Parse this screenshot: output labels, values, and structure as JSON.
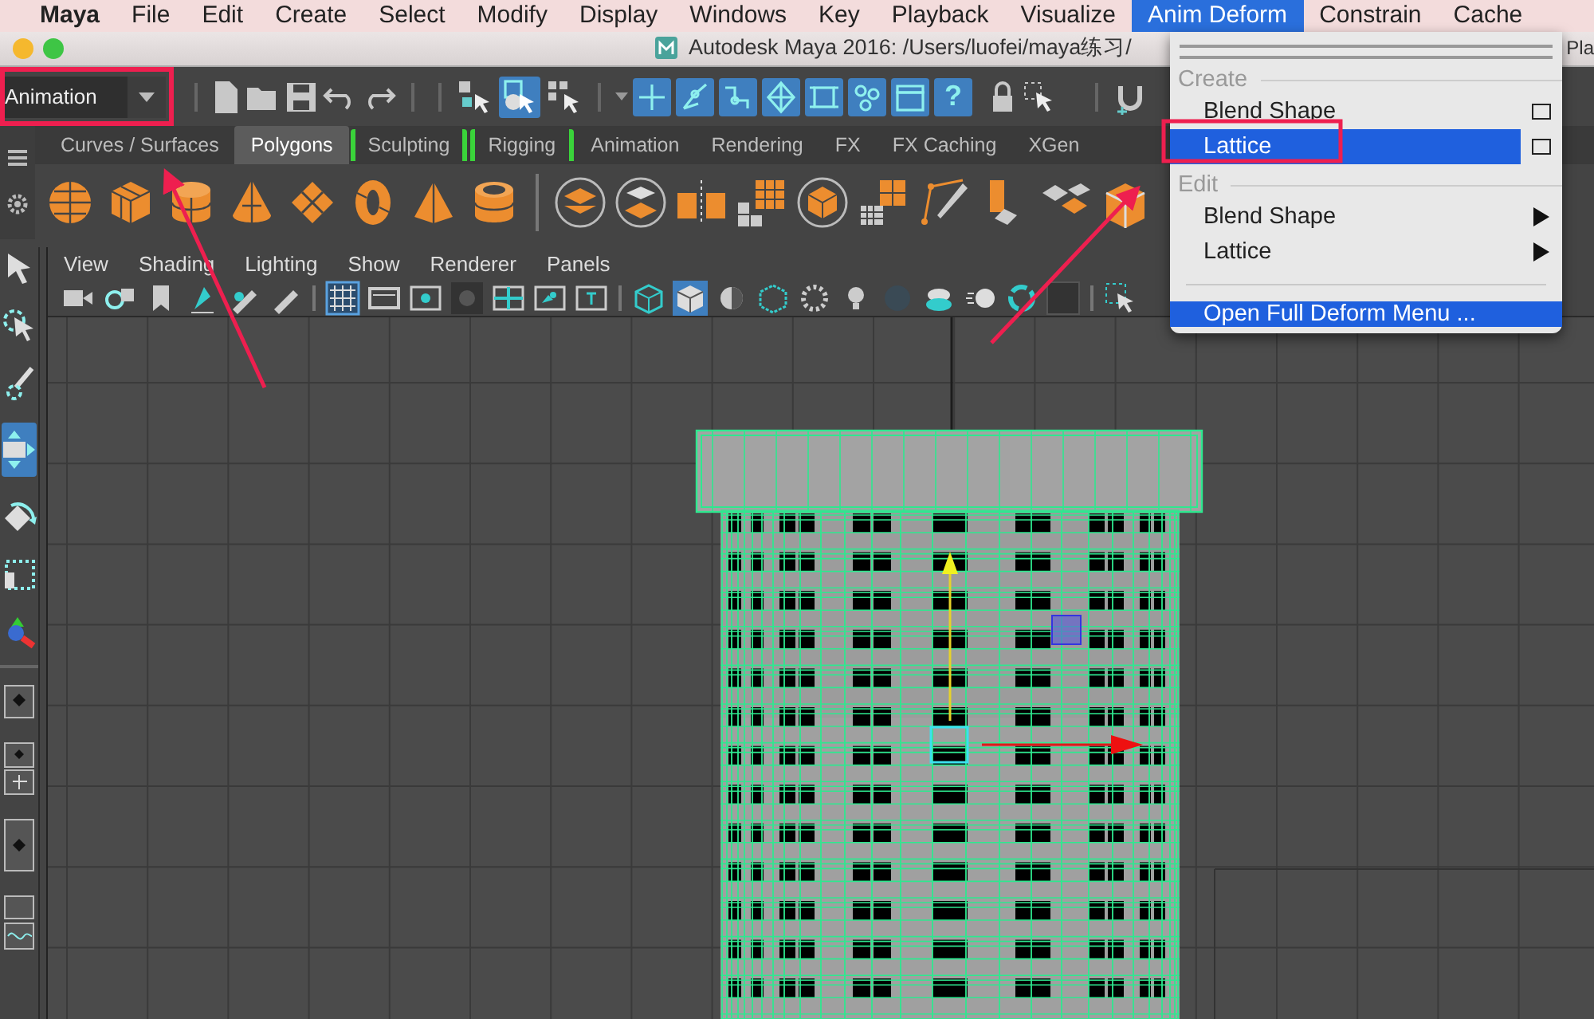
{
  "menu_bar": {
    "items": [
      {
        "label": "Maya",
        "kind": "app",
        "selected": false
      },
      {
        "label": "File",
        "kind": "menu",
        "selected": false
      },
      {
        "label": "Edit",
        "kind": "menu",
        "selected": false
      },
      {
        "label": "Create",
        "kind": "menu",
        "selected": false
      },
      {
        "label": "Select",
        "kind": "menu",
        "selected": false
      },
      {
        "label": "Modify",
        "kind": "menu",
        "selected": false
      },
      {
        "label": "Display",
        "kind": "menu",
        "selected": false
      },
      {
        "label": "Windows",
        "kind": "menu",
        "selected": false
      },
      {
        "label": "Key",
        "kind": "menu",
        "selected": false
      },
      {
        "label": "Playback",
        "kind": "menu",
        "selected": false
      },
      {
        "label": "Visualize",
        "kind": "menu",
        "selected": false
      },
      {
        "label": "Anim Deform",
        "kind": "menu",
        "selected": true
      },
      {
        "label": "Constrain",
        "kind": "menu",
        "selected": false
      },
      {
        "label": "Cache",
        "kind": "menu",
        "selected": false
      }
    ]
  },
  "window": {
    "title": "Autodesk Maya 2016: /Users/luofei/maya练习/",
    "title_tail": "Pla"
  },
  "menu_set": {
    "value": "Animation"
  },
  "toolbar": {
    "help_glyph": "?"
  },
  "shelf_tabs": [
    {
      "label": "Curves / Surfaces",
      "kind": "plain",
      "selected": false
    },
    {
      "label": "Polygons",
      "kind": "plain",
      "selected": true
    },
    {
      "label": "Sculpting",
      "kind": "bracketed",
      "selected": false
    },
    {
      "label": "Rigging",
      "kind": "bracketed",
      "selected": false
    },
    {
      "label": "Animation",
      "kind": "plain",
      "selected": false
    },
    {
      "label": "Rendering",
      "kind": "plain",
      "selected": false
    },
    {
      "label": "FX",
      "kind": "plain",
      "selected": false
    },
    {
      "label": "FX Caching",
      "kind": "plain",
      "selected": false
    },
    {
      "label": "XGen",
      "kind": "plain",
      "selected": false
    }
  ],
  "panel_menu": [
    "View",
    "Shading",
    "Lighting",
    "Show",
    "Renderer",
    "Panels"
  ],
  "deform_menu": {
    "items": [
      {
        "kind": "section",
        "label": "Create"
      },
      {
        "kind": "option",
        "label": "Blend Shape",
        "selected": false
      },
      {
        "kind": "option",
        "label": "Lattice",
        "selected": true
      },
      {
        "kind": "section",
        "label": "Edit"
      },
      {
        "kind": "submenu",
        "label": "Blend Shape",
        "selected": false
      },
      {
        "kind": "submenu",
        "label": "Lattice",
        "selected": false
      },
      {
        "kind": "separator"
      },
      {
        "kind": "plain",
        "label": "Open Full Deform Menu ...",
        "selected": true
      }
    ]
  }
}
